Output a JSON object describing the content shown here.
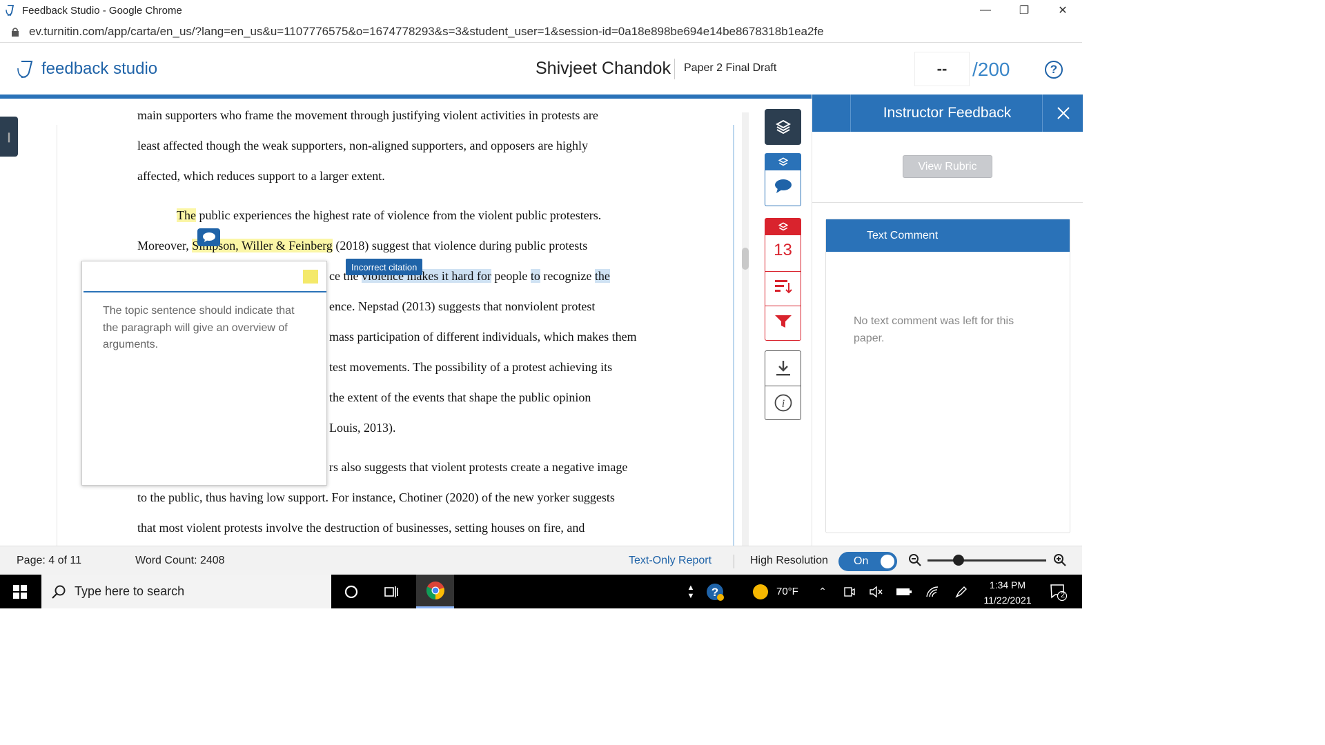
{
  "browser": {
    "window_title": "Feedback Studio - Google Chrome",
    "url": "ev.turnitin.com/app/carta/en_us/?lang=en_us&u=1107776575&o=1674778293&s=3&student_user=1&session-id=0a18e898be694e14be8678318b1ea2fe"
  },
  "header": {
    "app_name": "feedback studio",
    "student_name": "Shivjeet Chandok",
    "paper_title": "Paper 2 Final Draft",
    "score_value": "--",
    "score_total": "/200",
    "help_label": "?"
  },
  "document": {
    "lines": [
      {
        "parts": [
          {
            "t": "main supporters who frame the movement through justifying violent activities in protests are",
            "h": ""
          }
        ]
      },
      {
        "parts": [
          {
            "t": "least affected though the weak supporters, non-aligned supporters, and opposers are highly",
            "h": ""
          }
        ]
      },
      {
        "parts": [
          {
            "t": "affected, which reduces support to a larger extent.",
            "h": ""
          }
        ]
      },
      {
        "parts": [
          {
            "t": "The",
            "h": "yellow"
          },
          {
            "t": " public experiences the highest rate of violence from the violent public protesters.",
            "h": ""
          }
        ]
      },
      {
        "parts": [
          {
            "t": "Moreover, ",
            "h": ""
          },
          {
            "t": "Simpson, Willer & Feinberg",
            "h": "yellow"
          },
          {
            "t": " (2018) suggest that violence during public protests",
            "h": ""
          }
        ]
      },
      {
        "parts": [
          {
            "t": "ce the ",
            "h": ""
          },
          {
            "t": "violence makes it hard for",
            "h": "blue"
          },
          {
            "t": " people ",
            "h": ""
          },
          {
            "t": "to",
            "h": "blue"
          },
          {
            "t": " recognize ",
            "h": ""
          },
          {
            "t": "the",
            "h": "blue"
          }
        ]
      },
      {
        "parts": [
          {
            "t": "ence. Nepstad (2013) suggests that nonviolent protest",
            "h": ""
          }
        ]
      },
      {
        "parts": [
          {
            "t": "mass participation of different individuals, which makes them",
            "h": ""
          }
        ]
      },
      {
        "parts": [
          {
            "t": "test movements. The possibility of a protest achieving its",
            "h": ""
          }
        ]
      },
      {
        "parts": [
          {
            "t": "the extent of the events that shape the public opinion",
            "h": ""
          }
        ]
      },
      {
        "parts": [
          {
            "t": "Louis, 2013).",
            "h": ""
          }
        ]
      },
      {
        "parts": [
          {
            "t": "rs also suggests that violent protests create a negative image",
            "h": ""
          }
        ]
      },
      {
        "parts": [
          {
            "t": "to the public, thus having low support. For instance, Chotiner (2020) of the new yorker suggests",
            "h": ""
          }
        ]
      },
      {
        "parts": [
          {
            "t": "that most violent protests involve the destruction of businesses, setting houses on fire, and",
            "h": ""
          }
        ]
      }
    ]
  },
  "quickmark_tag": "Incorrect citation",
  "comment_card": {
    "text": "The topic sentence should indicate that the paragraph will give an overview of arguments.",
    "swatch_color": "#f4e96a"
  },
  "tools": {
    "flag_count": "13",
    "layer_color_blue": "#2a72b8",
    "layer_color_red": "#d9232d"
  },
  "right_panel": {
    "title": "Instructor Feedback",
    "view_rubric_label": "View Rubric",
    "text_comment_title": "Text Comment",
    "text_comment_empty": "No text comment was left for this paper."
  },
  "status": {
    "page": "Page: 4 of 11",
    "word_count": "Word Count: 2408",
    "text_only_report": "Text-Only Report",
    "high_resolution": "High Resolution",
    "toggle_state": "On"
  },
  "taskbar": {
    "search_placeholder": "Type here to search",
    "temperature": "70°F",
    "time": "1:34 PM",
    "date": "11/22/2021",
    "notification_count": "2"
  }
}
